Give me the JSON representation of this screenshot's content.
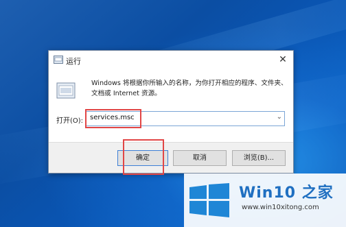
{
  "dialog": {
    "title": "运行",
    "description": "Windows 将根据你所输入的名称，为你打开相应的程序、文件夹、文档或 Internet 资源。",
    "open_label": "打开(O):",
    "open_value": "services.msc",
    "buttons": {
      "ok": "确定",
      "cancel": "取消",
      "browse": "浏览(B)..."
    }
  },
  "brand": {
    "name": "Win10 之家",
    "url": "www.win10xitong.com"
  },
  "colors": {
    "highlight": "#e14545",
    "accent": "#1f6fc1"
  }
}
